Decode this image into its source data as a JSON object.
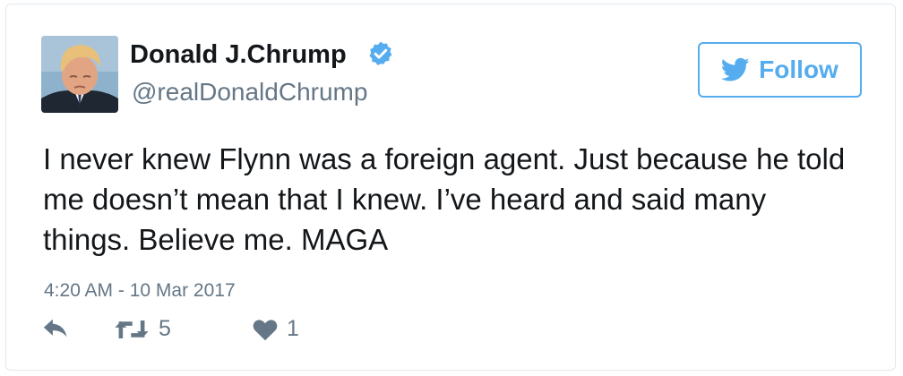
{
  "user": {
    "display_name": "Donald J.Chrump",
    "handle": "@realDonaldChrump",
    "verified": true,
    "avatar_icon": "profile-photo"
  },
  "follow_button": {
    "label": "Follow",
    "icon": "twitter-bird-icon",
    "color": "#55acee"
  },
  "tweet": {
    "text": "I never knew Flynn was a foreign agent. Just because he told me doesn’t mean that I knew. I’ve heard and said many things. Believe me. MAGA",
    "timestamp": "4:20 AM - 10 Mar 2017"
  },
  "actions": {
    "reply_icon": "reply-icon",
    "retweet_icon": "retweet-icon",
    "retweet_count": "5",
    "like_icon": "heart-icon",
    "like_count": "1"
  },
  "colors": {
    "text": "#14171a",
    "secondary": "#657786",
    "accent": "#55acee",
    "border": "#e1e8ed"
  }
}
